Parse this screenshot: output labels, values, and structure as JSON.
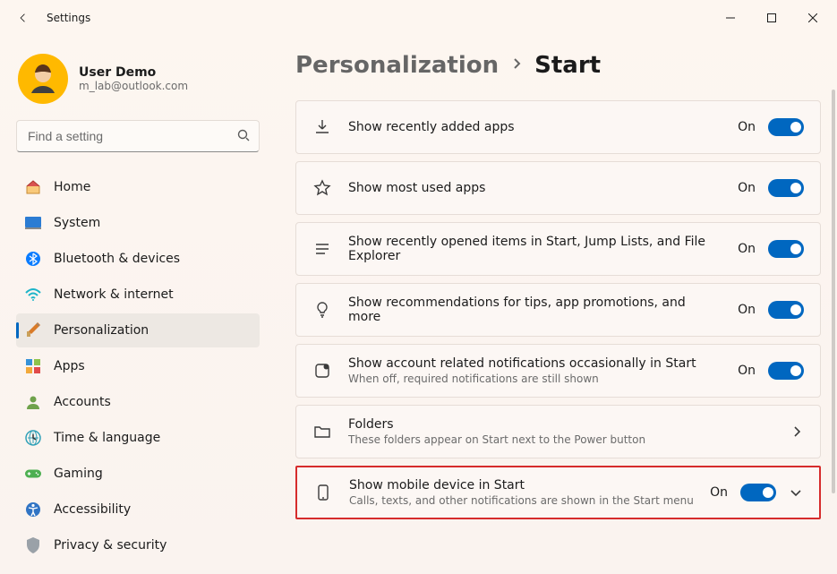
{
  "app_title": "Settings",
  "user": {
    "name": "User Demo",
    "email": "m_lab@outlook.com"
  },
  "search": {
    "placeholder": "Find a setting"
  },
  "nav": [
    {
      "key": "home",
      "icon": "home",
      "label": "Home"
    },
    {
      "key": "system",
      "icon": "system",
      "label": "System"
    },
    {
      "key": "bluetooth",
      "icon": "bluetooth",
      "label": "Bluetooth & devices"
    },
    {
      "key": "network",
      "icon": "network",
      "label": "Network & internet"
    },
    {
      "key": "personalization",
      "icon": "personalization",
      "label": "Personalization",
      "selected": true
    },
    {
      "key": "apps",
      "icon": "apps",
      "label": "Apps"
    },
    {
      "key": "accounts",
      "icon": "accounts",
      "label": "Accounts"
    },
    {
      "key": "time",
      "icon": "time",
      "label": "Time & language"
    },
    {
      "key": "gaming",
      "icon": "gaming",
      "label": "Gaming"
    },
    {
      "key": "accessibility",
      "icon": "accessibility",
      "label": "Accessibility"
    },
    {
      "key": "privacy",
      "icon": "privacy",
      "label": "Privacy & security"
    }
  ],
  "breadcrumb": {
    "parent": "Personalization",
    "current": "Start"
  },
  "cards": [
    {
      "key": "recently-added",
      "icon": "download",
      "title": "Show recently added apps",
      "state": "On",
      "toggle": true
    },
    {
      "key": "most-used",
      "icon": "star",
      "title": "Show most used apps",
      "state": "On",
      "toggle": true
    },
    {
      "key": "recent-items",
      "icon": "list",
      "title": "Show recently opened items in Start, Jump Lists, and File Explorer",
      "state": "On",
      "toggle": true
    },
    {
      "key": "recommendations",
      "icon": "bulb",
      "title": "Show recommendations for tips, app promotions, and more",
      "state": "On",
      "toggle": true
    },
    {
      "key": "account-notifications",
      "icon": "notify",
      "title": "Show account related notifications occasionally in Start",
      "sub": "When off, required notifications are still shown",
      "state": "On",
      "toggle": true
    },
    {
      "key": "folders",
      "icon": "folder",
      "title": "Folders",
      "sub": "These folders appear on Start next to the Power button",
      "chevron": true
    },
    {
      "key": "mobile-device",
      "icon": "phone",
      "title": "Show mobile device in Start",
      "sub": "Calls, texts, and other notifications are shown in the Start menu",
      "state": "On",
      "toggle": true,
      "expand": true,
      "highlight": true
    }
  ]
}
